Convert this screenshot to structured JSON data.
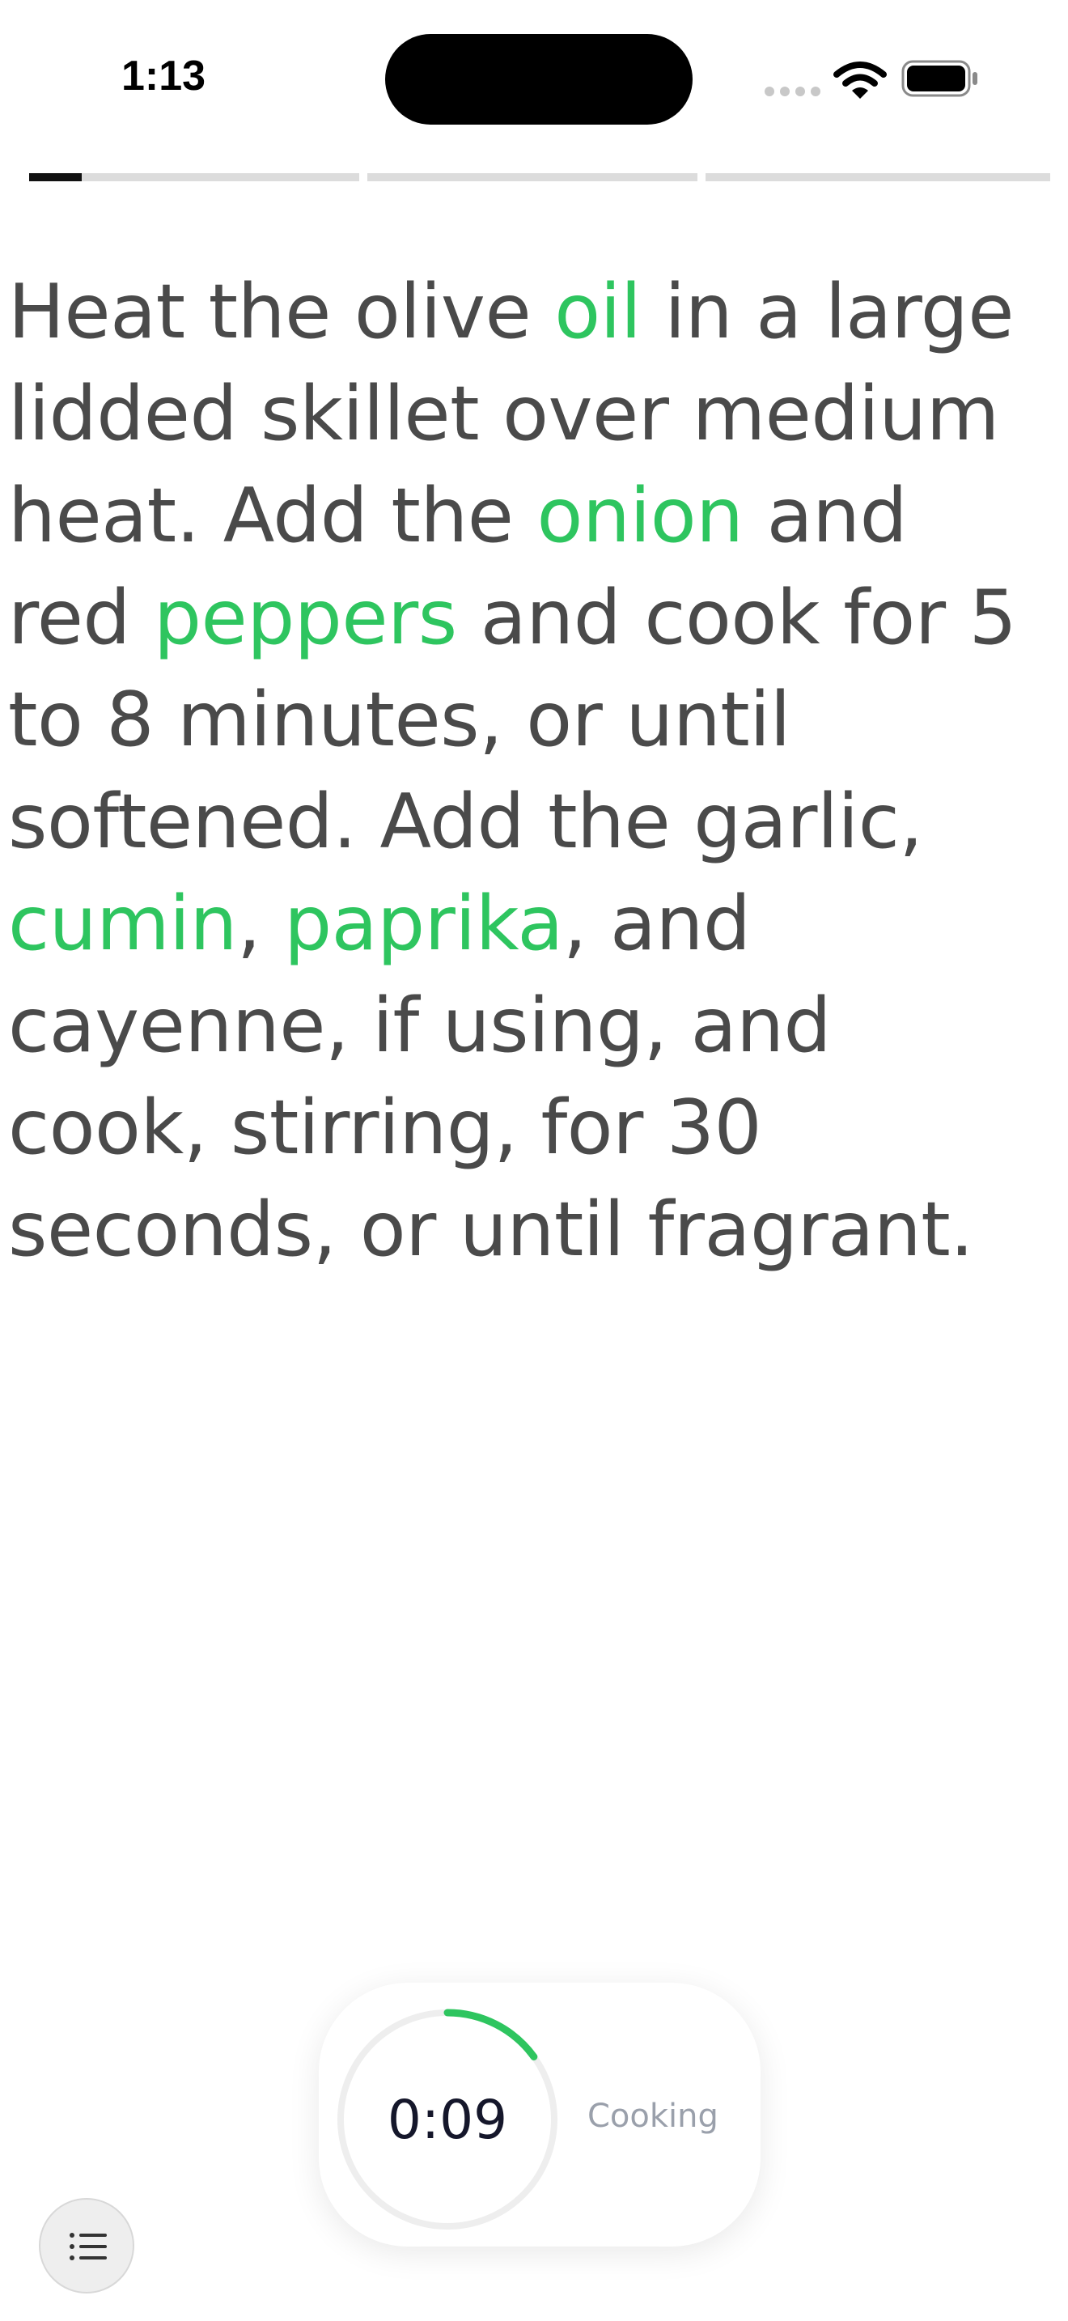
{
  "status_bar": {
    "time": "1:13",
    "icons": [
      "cellular-dots-icon",
      "wifi-icon",
      "battery-icon"
    ]
  },
  "step_progress": {
    "total_steps": 3,
    "current_step": 1,
    "current_step_fraction": 0.16
  },
  "instruction": {
    "segments": [
      {
        "text": "Heat the olive ",
        "ingredient": false
      },
      {
        "text": "oil",
        "ingredient": true
      },
      {
        "text": " in a large lidded skillet over medium heat. Add the ",
        "ingredient": false
      },
      {
        "text": "onion",
        "ingredient": true
      },
      {
        "text": " and red ",
        "ingredient": false
      },
      {
        "text": "peppers",
        "ingredient": true
      },
      {
        "text": " and cook for 5 to 8 minutes, or until softened. Add the garlic, ",
        "ingredient": false
      },
      {
        "text": "cumin",
        "ingredient": true
      },
      {
        "text": ", ",
        "ingredient": false
      },
      {
        "text": "paprika",
        "ingredient": true
      },
      {
        "text": ", and cayenne, if using, and cook, stirring, for 30 seconds, or until fragrant.",
        "ingredient": false
      }
    ]
  },
  "timer": {
    "time": "0:09",
    "label": "Cooking",
    "progress": 0.15
  },
  "colors": {
    "ingredient": "#2ec55f",
    "text": "#4a4a4a",
    "timer_arc": "#2ec55f",
    "timer_track": "#eeeeee"
  },
  "bottom": {
    "steps_list_icon": "list-icon"
  }
}
